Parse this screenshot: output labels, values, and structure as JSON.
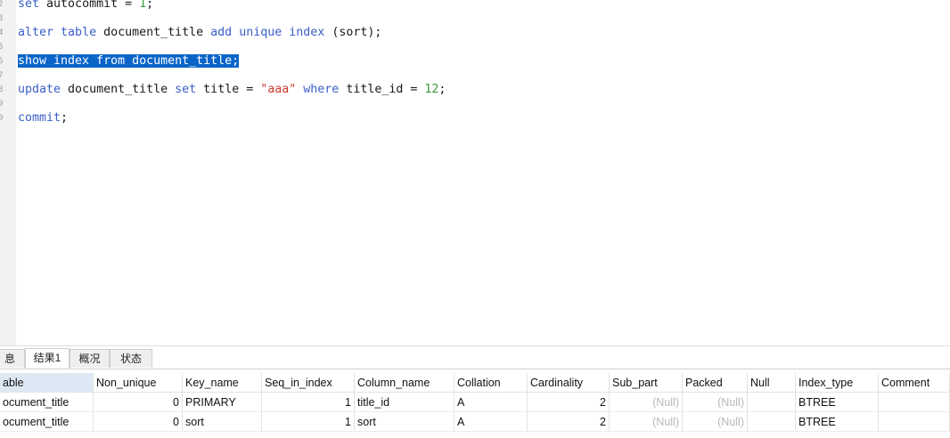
{
  "editor": {
    "lines": [
      {
        "num": "2",
        "tokens": [
          {
            "t": "set",
            "c": "kw"
          },
          {
            "t": " autocommit = "
          },
          {
            "t": "1",
            "c": "num"
          },
          {
            "t": ";"
          }
        ]
      },
      {
        "num": "3",
        "tokens": []
      },
      {
        "num": "4",
        "tokens": [
          {
            "t": "alter",
            "c": "kw"
          },
          {
            "t": " "
          },
          {
            "t": "table",
            "c": "kw"
          },
          {
            "t": " document_title "
          },
          {
            "t": "add",
            "c": "kw"
          },
          {
            "t": " "
          },
          {
            "t": "unique",
            "c": "kw"
          },
          {
            "t": " "
          },
          {
            "t": "index",
            "c": "kw"
          },
          {
            "t": " (sort);"
          }
        ]
      },
      {
        "num": "5",
        "tokens": []
      },
      {
        "num": "6",
        "tokens": [
          {
            "t": "show index from document_title;",
            "c": "sel"
          }
        ]
      },
      {
        "num": "7",
        "tokens": []
      },
      {
        "num": "8",
        "tokens": [
          {
            "t": "update",
            "c": "kw"
          },
          {
            "t": " document_title "
          },
          {
            "t": "set",
            "c": "kw"
          },
          {
            "t": " title = "
          },
          {
            "t": "\"aaa\"",
            "c": "str"
          },
          {
            "t": " "
          },
          {
            "t": "where",
            "c": "kw"
          },
          {
            "t": " title_id = "
          },
          {
            "t": "12",
            "c": "num"
          },
          {
            "t": ";"
          }
        ]
      },
      {
        "num": "9",
        "tokens": []
      },
      {
        "num": "0",
        "tokens": [
          {
            "t": "commit",
            "c": "kw"
          },
          {
            "t": ";"
          }
        ]
      }
    ]
  },
  "tabs": [
    {
      "label": "息",
      "active": false
    },
    {
      "label": "结果1",
      "active": true
    },
    {
      "label": "概况",
      "active": false
    },
    {
      "label": "状态",
      "active": false
    }
  ],
  "grid": {
    "columns": [
      "able",
      "Non_unique",
      "Key_name",
      "Seq_in_index",
      "Column_name",
      "Collation",
      "Cardinality",
      "Sub_part",
      "Packed",
      "Null",
      "Index_type",
      "Comment"
    ],
    "rows": [
      [
        "ocument_title",
        "0",
        "PRIMARY",
        "1",
        "title_id",
        "A",
        "2",
        "(Null)",
        "(Null)",
        "",
        "BTREE",
        ""
      ],
      [
        "ocument_title",
        "0",
        "sort",
        "1",
        "sort",
        "A",
        "2",
        "(Null)",
        "(Null)",
        "",
        "BTREE",
        ""
      ]
    ]
  }
}
